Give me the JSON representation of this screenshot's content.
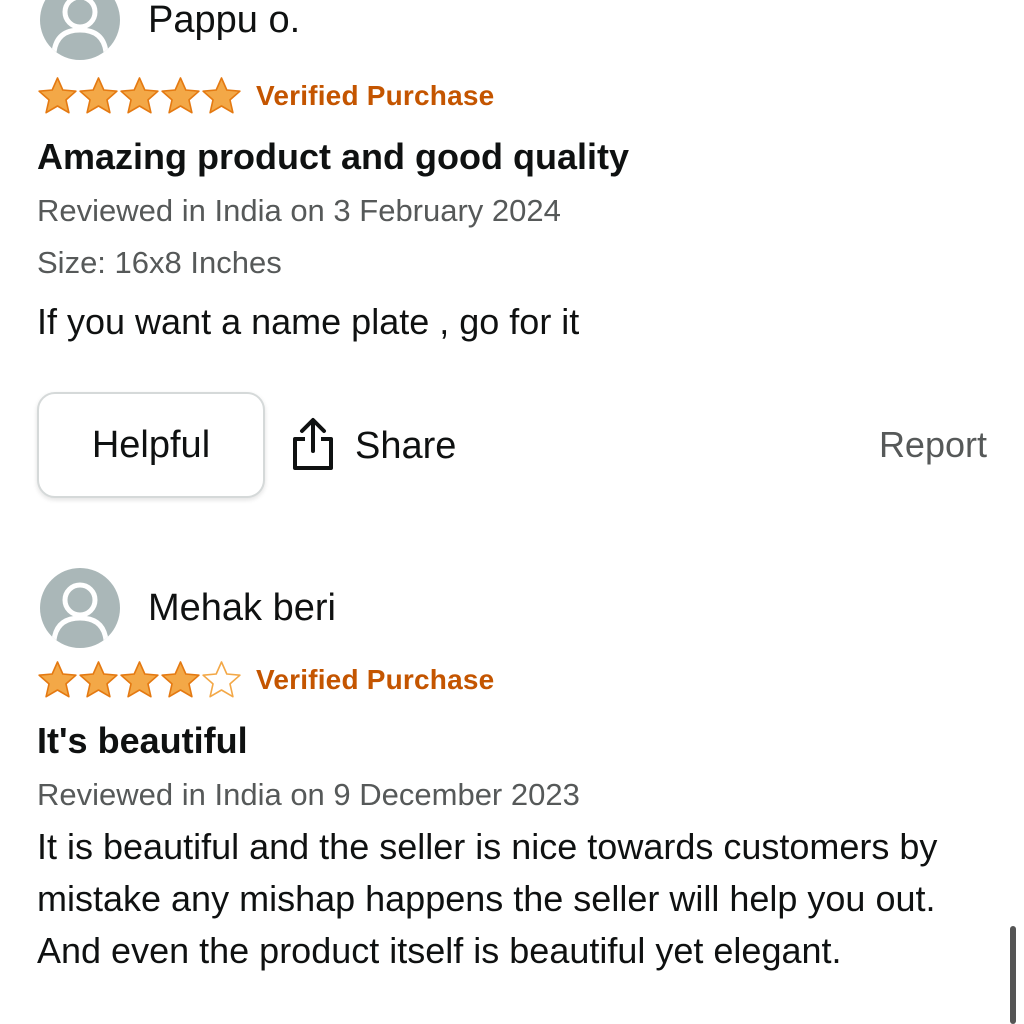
{
  "colors": {
    "star": "#f3a847",
    "verified": "#c45500",
    "meta": "#565959",
    "avatar": "#aab7b8"
  },
  "reviews": [
    {
      "reviewer": "Pappu o.",
      "rating": 5,
      "verified": "Verified Purchase",
      "title": "Amazing product and good quality",
      "date": "Reviewed in India on 3 February 2024",
      "size": "Size: 16x8 Inches",
      "body": "If you want a name plate , go for it",
      "actions": {
        "helpful": "Helpful",
        "share": "Share",
        "report": "Report"
      }
    },
    {
      "reviewer": "Mehak beri",
      "rating": 4,
      "verified": "Verified Purchase",
      "title": "It's beautiful",
      "date": "Reviewed in India on 9 December 2023",
      "body": "It is beautiful and the seller is nice towards customers by mistake any mishap happens the seller will help you out. And even the product itself is beautiful yet elegant."
    }
  ],
  "icons": {
    "avatar": "default-user-avatar-icon",
    "star_filled": "star-filled-icon",
    "star_empty": "star-outline-icon",
    "share": "share-icon"
  }
}
